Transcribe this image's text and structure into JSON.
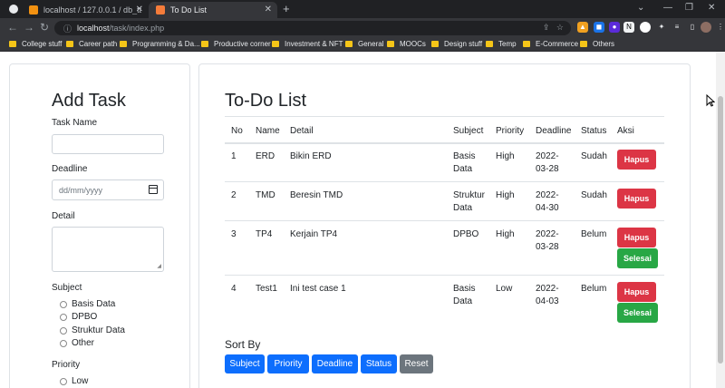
{
  "browser": {
    "tabs": [
      {
        "label": "localhost / 127.0.0.1 / db_task / t",
        "active": false
      },
      {
        "label": "To Do List",
        "active": true
      }
    ],
    "url_host": "localhost",
    "url_path": "/task/index.php",
    "bookmarks": [
      "College stuff",
      "Career path",
      "Programming & Da...",
      "Productive corner",
      "Investment & NFT",
      "General",
      "MOOCs",
      "Design stuff",
      "Temp",
      "E-Commerce",
      "Others"
    ]
  },
  "form": {
    "title": "Add Task",
    "task_name_label": "Task Name",
    "deadline_label": "Deadline",
    "deadline_placeholder": "dd/mm/yyyy",
    "detail_label": "Detail",
    "subject_label": "Subject",
    "subjects": [
      "Basis Data",
      "DPBO",
      "Struktur Data",
      "Other"
    ],
    "priority_label": "Priority",
    "priorities": [
      "Low"
    ]
  },
  "list": {
    "title": "To-Do List",
    "headers": [
      "No",
      "Name",
      "Detail",
      "Subject",
      "Priority",
      "Deadline",
      "Status",
      "Aksi"
    ],
    "rows": [
      {
        "no": "1",
        "name": "ERD",
        "detail": "Bikin ERD",
        "subject_1": "Basis",
        "subject_2": "Data",
        "priority": "High",
        "deadline_1": "2022-",
        "deadline_2": "03-28",
        "status": "Sudah"
      },
      {
        "no": "2",
        "name": "TMD",
        "detail": "Beresin TMD",
        "subject_1": "Struktur",
        "subject_2": "Data",
        "priority": "High",
        "deadline_1": "2022-",
        "deadline_2": "04-30",
        "status": "Sudah"
      },
      {
        "no": "3",
        "name": "TP4",
        "detail": "Kerjain TP4",
        "subject_1": "DPBO",
        "subject_2": "",
        "priority": "High",
        "deadline_1": "2022-",
        "deadline_2": "03-28",
        "status": "Belum"
      },
      {
        "no": "4",
        "name": "Test1",
        "detail": "Ini test case 1",
        "subject_1": "Basis",
        "subject_2": "Data",
        "priority": "Low",
        "deadline_1": "2022-",
        "deadline_2": "04-03",
        "status": "Belum"
      }
    ],
    "delete_label": "Hapus",
    "done_label": "Selesai"
  },
  "sort": {
    "title": "Sort By",
    "buttons": [
      "Subject",
      "Priority",
      "Deadline",
      "Status",
      "Reset"
    ]
  },
  "colors": {
    "danger": "#dc3545",
    "success": "#28a745",
    "primary": "#0d6efd",
    "secondary": "#6c757d"
  }
}
